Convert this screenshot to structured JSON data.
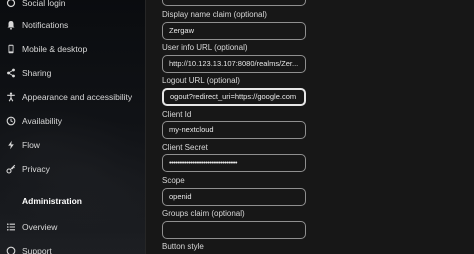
{
  "sidebar": {
    "items": [
      {
        "label": "Social login",
        "icon": "social-login-icon"
      },
      {
        "label": "Notifications",
        "icon": "bell-icon"
      },
      {
        "label": "Mobile & desktop",
        "icon": "mobile-icon"
      },
      {
        "label": "Sharing",
        "icon": "share-icon"
      },
      {
        "label": "Appearance and accessibility",
        "icon": "accessibility-icon"
      },
      {
        "label": "Availability",
        "icon": "clock-icon"
      },
      {
        "label": "Flow",
        "icon": "flow-icon"
      },
      {
        "label": "Privacy",
        "icon": "key-icon"
      }
    ],
    "admin_header": "Administration",
    "admin_items": [
      {
        "label": "Overview",
        "icon": "list-icon"
      },
      {
        "label": "Support",
        "icon": "support-icon"
      }
    ]
  },
  "form": {
    "display_name_claim": {
      "label": "Display name claim (optional)",
      "value": "Zergaw"
    },
    "user_info_url": {
      "label": "User info URL (optional)",
      "value": "http://10.123.13.107:8080/realms/Zer..."
    },
    "logout_url": {
      "label": "Logout URL (optional)",
      "value": "ogout?redirect_uri=https://google.com"
    },
    "client_id": {
      "label": "Client Id",
      "value": "my-nextcloud"
    },
    "client_secret": {
      "label": "Client Secret",
      "value": "••••••••••••••••••••••••••••••••"
    },
    "scope": {
      "label": "Scope",
      "value": "openid"
    },
    "groups_claim": {
      "label": "Groups claim (optional)",
      "value": ""
    },
    "button_style": {
      "label": "Button style"
    }
  }
}
